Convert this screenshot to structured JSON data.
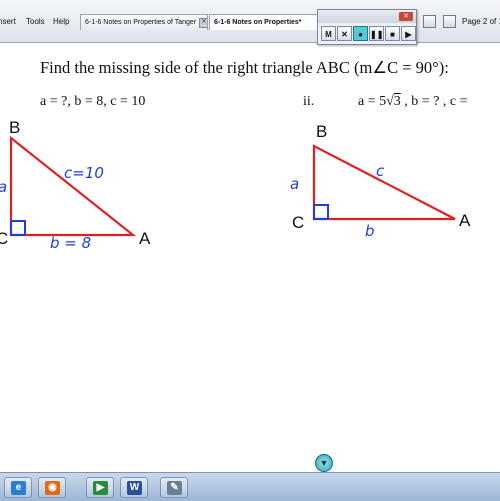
{
  "menu": {
    "insert_label": "nsert",
    "tools_label": "Tools",
    "help_label": "Help"
  },
  "tabs": [
    {
      "label": "6-1-6 Notes on Properties of Tanger",
      "active": false
    },
    {
      "label": "6-1-6 Notes on Properties*",
      "active": true
    }
  ],
  "page_indicator": "Page 2 of 1",
  "recorder": {
    "buttons": [
      {
        "name": "mute",
        "glyph": "M"
      },
      {
        "name": "cancel",
        "glyph": "✕"
      },
      {
        "name": "record",
        "glyph": "●"
      },
      {
        "name": "pause",
        "glyph": "❚❚"
      },
      {
        "name": "stop",
        "glyph": "■"
      },
      {
        "name": "play",
        "glyph": "▶"
      }
    ],
    "close_glyph": "✕"
  },
  "worksheet": {
    "heading": "Find the missing  side of the right triangle ABC (m∠C = 90°):",
    "part_i": {
      "given": "a = ?, b = 8, c = 10",
      "vertices": {
        "A": "A",
        "B": "B",
        "C": "C"
      },
      "handwriting": {
        "a": "a",
        "b": "b = 8",
        "c": "c=10"
      }
    },
    "part_ii": {
      "label": "ii.",
      "given_prefix": "a = 5",
      "given_radicand": "3",
      "given_suffix": ", b = ? , c =",
      "vertices": {
        "A": "A",
        "B": "B",
        "C": "C"
      },
      "handwriting": {
        "a": "a",
        "b": "b",
        "c": "c"
      }
    }
  },
  "scroll_button_glyph": "▼",
  "taskbar": {
    "apps": [
      {
        "name": "internet-explorer",
        "glyph": "e",
        "color": "#2a7fd4"
      },
      {
        "name": "firefox",
        "glyph": "◉",
        "color": "#e06a1b"
      },
      {
        "name": "media-player",
        "glyph": "▶",
        "color": "#2c8a3b"
      },
      {
        "name": "word",
        "glyph": "W",
        "color": "#2b4f9e"
      },
      {
        "name": "smart-notebook",
        "glyph": "✎",
        "color": "#6b7d94"
      }
    ]
  },
  "colors": {
    "triangle": "#e02020",
    "handwriting": "#1f3fd8",
    "right_angle_mark": "#1f3fd8"
  }
}
